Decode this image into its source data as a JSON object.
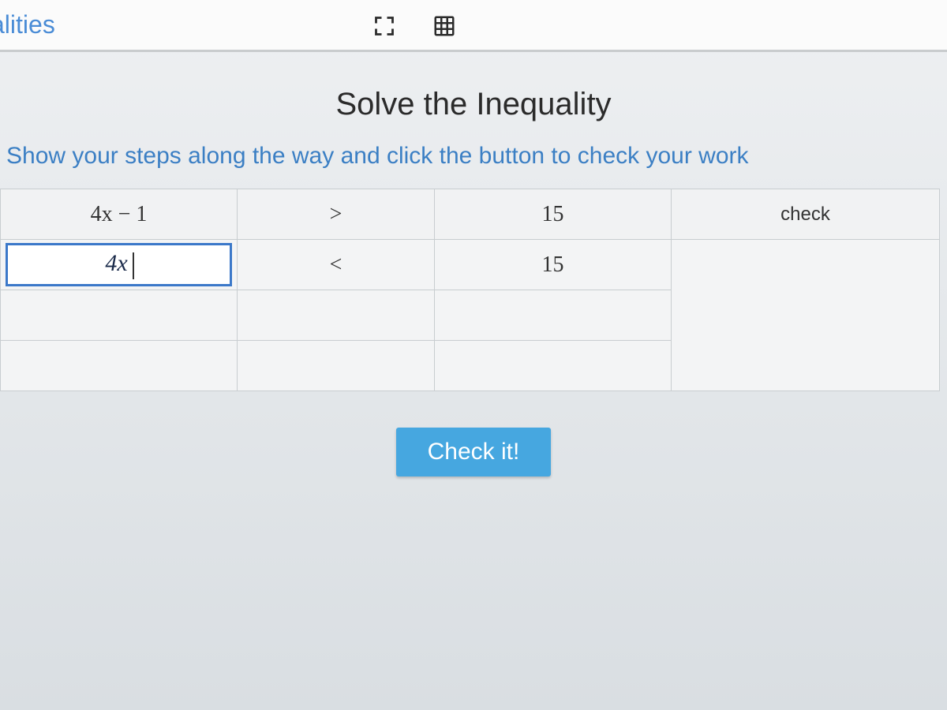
{
  "topbar": {
    "title_fragment": "alities",
    "icons": {
      "fullscreen": "fullscreen-icon",
      "table_view": "table-icon"
    }
  },
  "page": {
    "title": "Solve the Inequality",
    "subtitle": "Show your steps along the way and click the button to check your work"
  },
  "table": {
    "header": {
      "lhs": "4x − 1",
      "op": ">",
      "rhs": "15",
      "check_label": "check"
    },
    "rows": [
      {
        "lhs_input": "4x",
        "op": "<",
        "rhs": "15",
        "check": ""
      },
      {
        "lhs_input": "",
        "op": "",
        "rhs": "",
        "check": ""
      },
      {
        "lhs_input": "",
        "op": "",
        "rhs": "",
        "check": ""
      }
    ]
  },
  "buttons": {
    "check_it": "Check it!"
  }
}
